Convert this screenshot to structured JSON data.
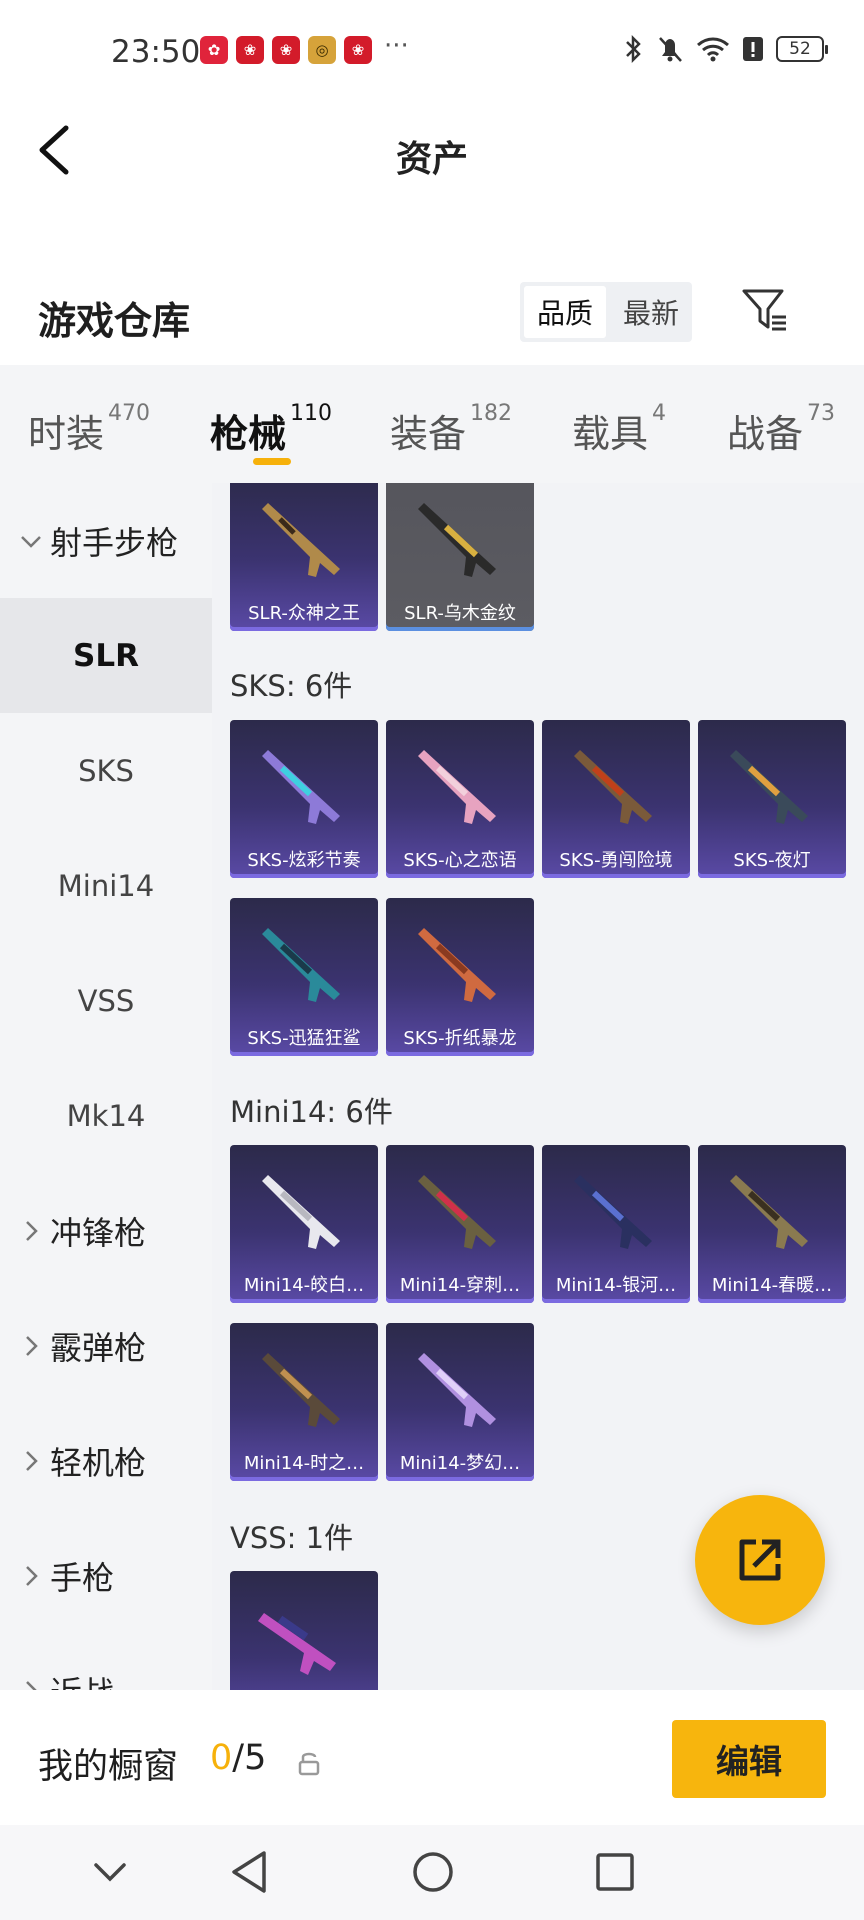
{
  "status_bar": {
    "time": "23:50",
    "battery": "52",
    "more": "···"
  },
  "header": {
    "title": "资产"
  },
  "section": {
    "title": "游戏仓库",
    "sort_options": [
      "品质",
      "最新"
    ]
  },
  "tabs": [
    {
      "label": "时装",
      "count": "470"
    },
    {
      "label": "枪械",
      "count": "110"
    },
    {
      "label": "装备",
      "count": "182"
    },
    {
      "label": "载具",
      "count": "4"
    },
    {
      "label": "战备",
      "count": "73"
    }
  ],
  "sidebar": {
    "items": [
      {
        "label": "射手步枪"
      },
      {
        "label": "SLR"
      },
      {
        "label": "SKS"
      },
      {
        "label": "Mini14"
      },
      {
        "label": "VSS"
      },
      {
        "label": "Mk14"
      },
      {
        "label": "冲锋枪"
      },
      {
        "label": "霰弹枪"
      },
      {
        "label": "轻机枪"
      },
      {
        "label": "手枪"
      },
      {
        "label": "近战"
      }
    ]
  },
  "groups": {
    "slr": {
      "items": [
        "SLR-众神之王",
        "SLR-乌木金纹"
      ]
    },
    "sks": {
      "title": "SKS: 6件",
      "items": [
        "SKS-炫彩节奏",
        "SKS-心之恋语",
        "SKS-勇闯险境",
        "SKS-夜灯",
        "SKS-迅猛狂鲨",
        "SKS-折纸暴龙"
      ]
    },
    "mini14": {
      "title": "Mini14: 6件",
      "items": [
        "Mini14-皎白…",
        "Mini14-穿刺…",
        "Mini14-银河…",
        "Mini14-春暖…",
        "Mini14-时之…",
        "Mini14-梦幻…"
      ]
    },
    "vss": {
      "title": "VSS: 1件"
    }
  },
  "bottom": {
    "window_label": "我的橱窗",
    "window_current": "0",
    "window_total": "/5",
    "edit_label": "编辑"
  },
  "colors": {
    "accent": "#f7b50d",
    "card_purple": "#3b3370",
    "card_gray": "#5c5c62"
  }
}
